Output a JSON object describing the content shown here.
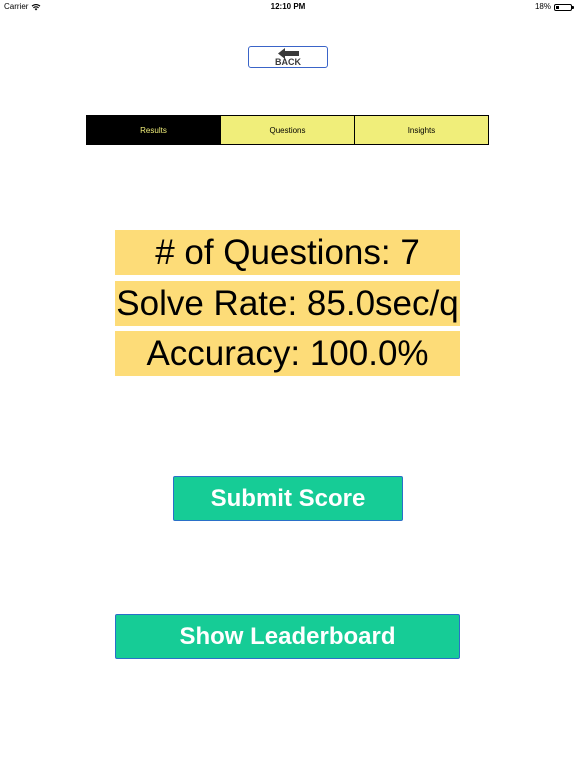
{
  "status_bar": {
    "carrier": "Carrier",
    "time": "12:10 PM",
    "battery_text": "18%",
    "battery_level": 0.18
  },
  "back_button": {
    "label": "BACK",
    "icon": "left-arrow-icon"
  },
  "tabs": [
    {
      "label": "Results",
      "active": true
    },
    {
      "label": "Questions",
      "active": false
    },
    {
      "label": "Insights",
      "active": false
    }
  ],
  "stats": {
    "questions": "# of Questions: 7",
    "solve_rate": "Solve Rate: 85.0sec/q",
    "accuracy": "Accuracy: 100.0%"
  },
  "actions": {
    "submit_label": "Submit Score",
    "leaderboard_label": "Show Leaderboard"
  },
  "colors": {
    "tab_inactive": "#f0ee7a",
    "tab_active": "#000000",
    "stat_background": "#fddc78",
    "button_background": "#16cc96",
    "button_border": "#2a70c8",
    "back_border": "#3a64c8"
  }
}
